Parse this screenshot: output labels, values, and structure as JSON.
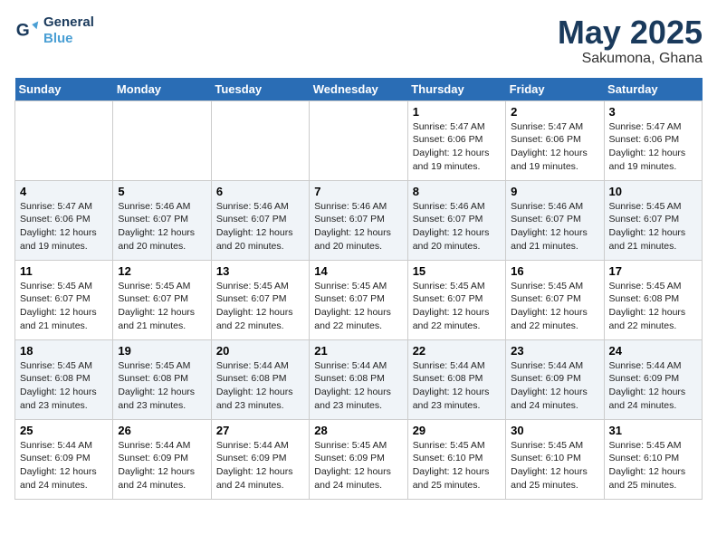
{
  "logo": {
    "line1": "General",
    "line2": "Blue"
  },
  "title": "May 2025",
  "location": "Sakumona, Ghana",
  "days_of_week": [
    "Sunday",
    "Monday",
    "Tuesday",
    "Wednesday",
    "Thursday",
    "Friday",
    "Saturday"
  ],
  "weeks": [
    [
      {
        "day": "",
        "info": ""
      },
      {
        "day": "",
        "info": ""
      },
      {
        "day": "",
        "info": ""
      },
      {
        "day": "",
        "info": ""
      },
      {
        "day": "1",
        "info": "Sunrise: 5:47 AM\nSunset: 6:06 PM\nDaylight: 12 hours\nand 19 minutes."
      },
      {
        "day": "2",
        "info": "Sunrise: 5:47 AM\nSunset: 6:06 PM\nDaylight: 12 hours\nand 19 minutes."
      },
      {
        "day": "3",
        "info": "Sunrise: 5:47 AM\nSunset: 6:06 PM\nDaylight: 12 hours\nand 19 minutes."
      }
    ],
    [
      {
        "day": "4",
        "info": "Sunrise: 5:47 AM\nSunset: 6:06 PM\nDaylight: 12 hours\nand 19 minutes."
      },
      {
        "day": "5",
        "info": "Sunrise: 5:46 AM\nSunset: 6:07 PM\nDaylight: 12 hours\nand 20 minutes."
      },
      {
        "day": "6",
        "info": "Sunrise: 5:46 AM\nSunset: 6:07 PM\nDaylight: 12 hours\nand 20 minutes."
      },
      {
        "day": "7",
        "info": "Sunrise: 5:46 AM\nSunset: 6:07 PM\nDaylight: 12 hours\nand 20 minutes."
      },
      {
        "day": "8",
        "info": "Sunrise: 5:46 AM\nSunset: 6:07 PM\nDaylight: 12 hours\nand 20 minutes."
      },
      {
        "day": "9",
        "info": "Sunrise: 5:46 AM\nSunset: 6:07 PM\nDaylight: 12 hours\nand 21 minutes."
      },
      {
        "day": "10",
        "info": "Sunrise: 5:45 AM\nSunset: 6:07 PM\nDaylight: 12 hours\nand 21 minutes."
      }
    ],
    [
      {
        "day": "11",
        "info": "Sunrise: 5:45 AM\nSunset: 6:07 PM\nDaylight: 12 hours\nand 21 minutes."
      },
      {
        "day": "12",
        "info": "Sunrise: 5:45 AM\nSunset: 6:07 PM\nDaylight: 12 hours\nand 21 minutes."
      },
      {
        "day": "13",
        "info": "Sunrise: 5:45 AM\nSunset: 6:07 PM\nDaylight: 12 hours\nand 22 minutes."
      },
      {
        "day": "14",
        "info": "Sunrise: 5:45 AM\nSunset: 6:07 PM\nDaylight: 12 hours\nand 22 minutes."
      },
      {
        "day": "15",
        "info": "Sunrise: 5:45 AM\nSunset: 6:07 PM\nDaylight: 12 hours\nand 22 minutes."
      },
      {
        "day": "16",
        "info": "Sunrise: 5:45 AM\nSunset: 6:07 PM\nDaylight: 12 hours\nand 22 minutes."
      },
      {
        "day": "17",
        "info": "Sunrise: 5:45 AM\nSunset: 6:08 PM\nDaylight: 12 hours\nand 22 minutes."
      }
    ],
    [
      {
        "day": "18",
        "info": "Sunrise: 5:45 AM\nSunset: 6:08 PM\nDaylight: 12 hours\nand 23 minutes."
      },
      {
        "day": "19",
        "info": "Sunrise: 5:45 AM\nSunset: 6:08 PM\nDaylight: 12 hours\nand 23 minutes."
      },
      {
        "day": "20",
        "info": "Sunrise: 5:44 AM\nSunset: 6:08 PM\nDaylight: 12 hours\nand 23 minutes."
      },
      {
        "day": "21",
        "info": "Sunrise: 5:44 AM\nSunset: 6:08 PM\nDaylight: 12 hours\nand 23 minutes."
      },
      {
        "day": "22",
        "info": "Sunrise: 5:44 AM\nSunset: 6:08 PM\nDaylight: 12 hours\nand 23 minutes."
      },
      {
        "day": "23",
        "info": "Sunrise: 5:44 AM\nSunset: 6:09 PM\nDaylight: 12 hours\nand 24 minutes."
      },
      {
        "day": "24",
        "info": "Sunrise: 5:44 AM\nSunset: 6:09 PM\nDaylight: 12 hours\nand 24 minutes."
      }
    ],
    [
      {
        "day": "25",
        "info": "Sunrise: 5:44 AM\nSunset: 6:09 PM\nDaylight: 12 hours\nand 24 minutes."
      },
      {
        "day": "26",
        "info": "Sunrise: 5:44 AM\nSunset: 6:09 PM\nDaylight: 12 hours\nand 24 minutes."
      },
      {
        "day": "27",
        "info": "Sunrise: 5:44 AM\nSunset: 6:09 PM\nDaylight: 12 hours\nand 24 minutes."
      },
      {
        "day": "28",
        "info": "Sunrise: 5:45 AM\nSunset: 6:09 PM\nDaylight: 12 hours\nand 24 minutes."
      },
      {
        "day": "29",
        "info": "Sunrise: 5:45 AM\nSunset: 6:10 PM\nDaylight: 12 hours\nand 25 minutes."
      },
      {
        "day": "30",
        "info": "Sunrise: 5:45 AM\nSunset: 6:10 PM\nDaylight: 12 hours\nand 25 minutes."
      },
      {
        "day": "31",
        "info": "Sunrise: 5:45 AM\nSunset: 6:10 PM\nDaylight: 12 hours\nand 25 minutes."
      }
    ]
  ]
}
